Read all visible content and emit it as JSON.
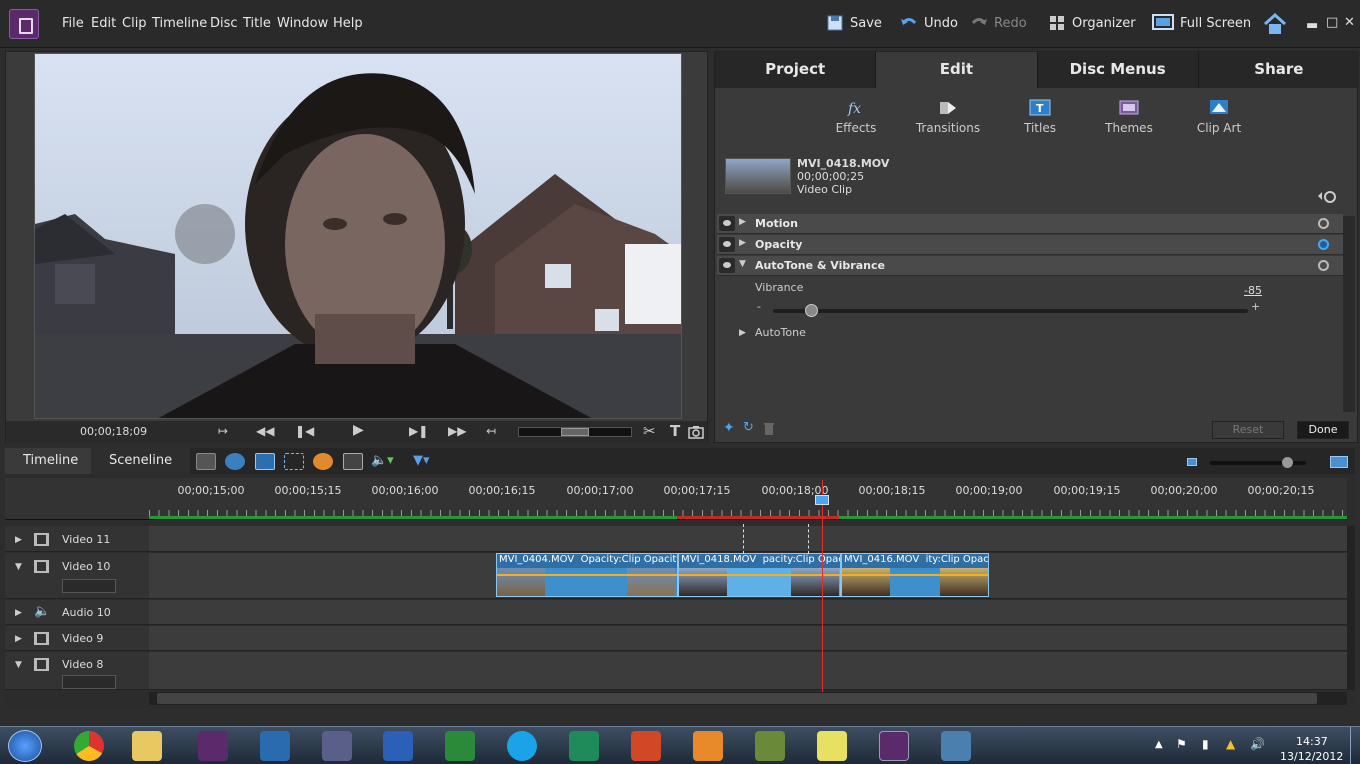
{
  "menu": [
    "File",
    "Edit",
    "Clip",
    "Timeline",
    "Disc",
    "Title",
    "Window",
    "Help"
  ],
  "toolbar": {
    "save": "Save",
    "undo": "Undo",
    "redo": "Redo",
    "organizer": "Organizer",
    "full_screen": "Full Screen"
  },
  "monitor": {
    "timecode": "00;00;18;09"
  },
  "panel": {
    "tabs": [
      "Project",
      "Edit",
      "Disc Menus",
      "Share"
    ],
    "active_tab": "Edit",
    "tools": [
      "Effects",
      "Transitions",
      "Titles",
      "Themes",
      "Clip Art"
    ],
    "clip": {
      "name": "MVI_0418.MOV",
      "duration": "00;00;00;25",
      "type": "Video Clip"
    },
    "effects": [
      {
        "label": "Motion"
      },
      {
        "label": "Opacity"
      },
      {
        "label": "AutoTone & Vibrance"
      }
    ],
    "vibrance": {
      "label": "Vibrance",
      "value": "-85",
      "min_label": "-",
      "max_label": "+",
      "level": 0.08
    },
    "autotone": "AutoTone",
    "reset": "Reset",
    "done": "Done"
  },
  "timeline": {
    "tabs": [
      "Timeline",
      "Sceneline"
    ],
    "ruler": [
      "00;00;15;00",
      "00;00;15;15",
      "00;00;16;00",
      "00;00;16;15",
      "00;00;17;00",
      "00;00;17;15",
      "00;00;18;00",
      "00;00;18;15",
      "00;00;19;00",
      "00;00;19;15",
      "00;00;20;00",
      "00;00;20;15"
    ],
    "tracks": [
      "Video 11",
      "Video 10",
      "Audio 10",
      "Video 9",
      "Video 8"
    ],
    "clips": [
      {
        "name": "MVI_0404.MOV",
        "effect": "Opacity:Clip Opacity"
      },
      {
        "name": "MVI_0418.MOV",
        "effect": "pacity:Clip Opacity"
      },
      {
        "name": "MVI_0416.MOV",
        "effect": "ity:Clip Opacity"
      }
    ]
  },
  "taskbar": {
    "time": "14:37",
    "date": "13/12/2012"
  }
}
